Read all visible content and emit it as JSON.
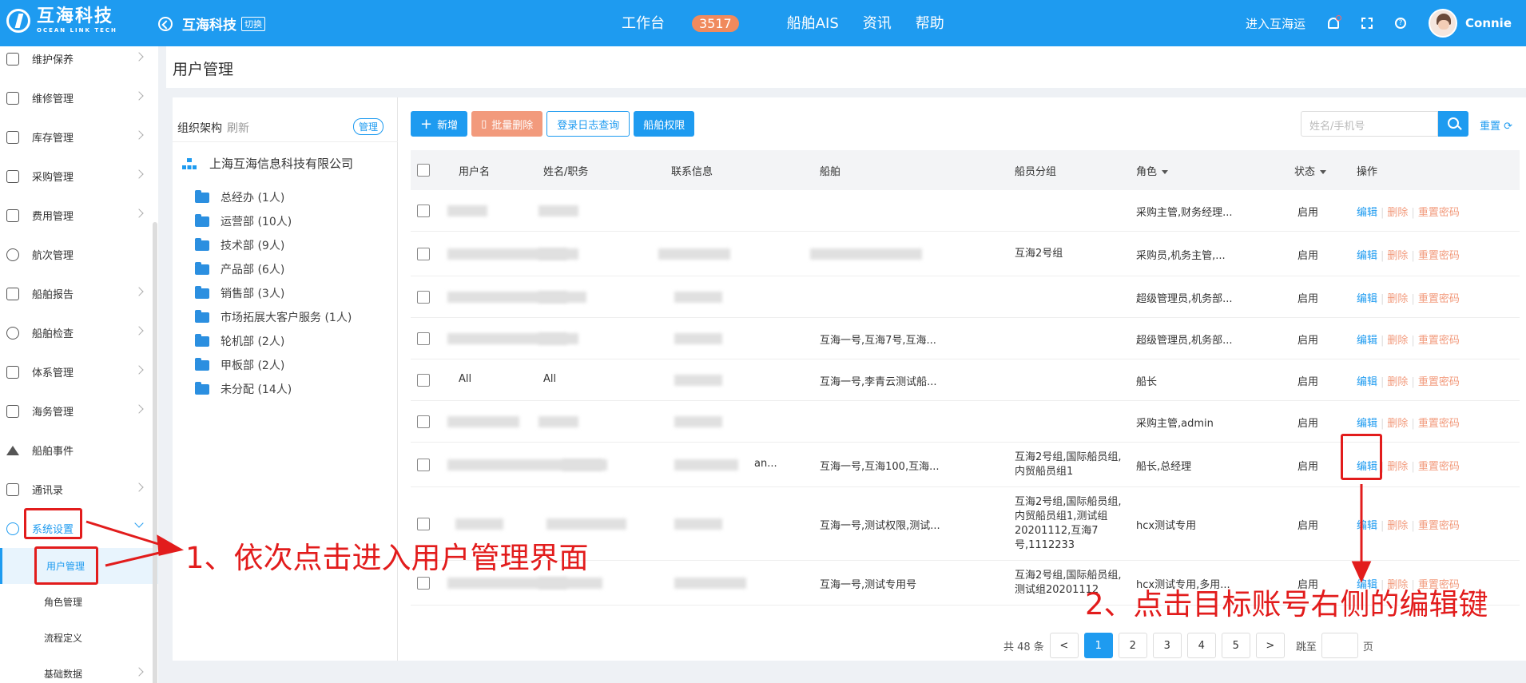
{
  "topbar": {
    "logo_cn": "互海科技",
    "logo_en": "OCEAN LINK TECH",
    "company": "互海科技",
    "switch_label": "切换",
    "nav": [
      {
        "label": "工作台",
        "badge": "3517"
      },
      {
        "label": "船舶AIS"
      },
      {
        "label": "资讯"
      },
      {
        "label": "帮助"
      }
    ],
    "enter_label": "进入互海运",
    "user": "Connie",
    "brand_color": "#1e9bf0"
  },
  "sidebar": {
    "items": [
      {
        "label": "维护保养",
        "icon": "hammer-icon"
      },
      {
        "label": "维修管理",
        "icon": "wrench-icon"
      },
      {
        "label": "库存管理",
        "icon": "warehouse-icon"
      },
      {
        "label": "采购管理",
        "icon": "cart-icon"
      },
      {
        "label": "费用管理",
        "icon": "database-icon"
      },
      {
        "label": "航次管理",
        "icon": "globe-icon"
      },
      {
        "label": "船舶报告",
        "icon": "calendar-icon"
      },
      {
        "label": "船舶检查",
        "icon": "check-circle-icon"
      },
      {
        "label": "体系管理",
        "icon": "document-icon"
      },
      {
        "label": "海务管理",
        "icon": "signpost-icon"
      },
      {
        "label": "船舶事件",
        "icon": "warning-icon"
      },
      {
        "label": "通讯录",
        "icon": "contacts-icon"
      },
      {
        "label": "系统设置",
        "icon": "gear-icon"
      }
    ],
    "subitems": [
      {
        "label": "用户管理"
      },
      {
        "label": "角色管理"
      },
      {
        "label": "流程定义"
      },
      {
        "label": "基础数据"
      }
    ]
  },
  "page_title": "用户管理",
  "org": {
    "title": "组织架构",
    "refresh": "刷新",
    "manage": "管理",
    "company": "上海互海信息科技有限公司",
    "departments": [
      "总经办 (1人)",
      "运营部 (10人)",
      "技术部 (9人)",
      "产品部 (6人)",
      "销售部 (3人)",
      "市场拓展大客户服务 (1人)",
      "轮机部 (2人)",
      "甲板部 (2人)",
      "未分配 (14人)"
    ]
  },
  "toolbar": {
    "add": "新增",
    "batch_delete": "批量删除",
    "login_log": "登录日志查询",
    "ship_perm": "船舶权限",
    "search_placeholder": "姓名/手机号",
    "reset": "重置"
  },
  "table": {
    "headers": [
      "用户名",
      "姓名/职务",
      "联系信息",
      "船舶",
      "船员分组",
      "角色",
      "状态",
      "操作"
    ],
    "op_edit": "编辑",
    "op_delete": "删除",
    "op_reset": "重置密码",
    "rows": [
      {
        "username": "",
        "name": "",
        "contact": "",
        "ship": "",
        "group": "",
        "role": "采购主管,财务经理...",
        "status": "启用"
      },
      {
        "username": "",
        "name": "",
        "contact": "",
        "ship": "",
        "group": "互海2号组",
        "role": "采购员,机务主管,...",
        "status": "启用"
      },
      {
        "username": "",
        "name": "",
        "contact": "",
        "ship": "",
        "group": "",
        "role": "超级管理员,机务部...",
        "status": "启用"
      },
      {
        "username": "",
        "name": "",
        "contact": "",
        "ship": "互海一号,互海7号,互海...",
        "group": "",
        "role": "超级管理员,机务部...",
        "status": "启用"
      },
      {
        "username": "All",
        "name": "All",
        "contact": "",
        "ship": "互海一号,李青云测试船...",
        "group": "",
        "role": "船长",
        "status": "启用"
      },
      {
        "username": "",
        "name": "",
        "contact": "",
        "ship": "",
        "group": "",
        "role": "采购主管,admin",
        "status": "启用"
      },
      {
        "username": "",
        "name": "",
        "contact": "an...",
        "ship": "互海一号,互海100,互海...",
        "group": "互海2号组,国际船员组,内贸船员组1",
        "role": "船长,总经理",
        "status": "启用"
      },
      {
        "username": "",
        "name": "",
        "contact": "",
        "ship": "互海一号,测试权限,测试...",
        "group": "互海2号组,国际船员组,内贸船员组1,测试组20201112,互海7号,1112233",
        "role": "hcx测试专用",
        "status": "启用"
      },
      {
        "username": "",
        "name": "",
        "contact": "",
        "ship": "互海一号,测试专用号",
        "group": "互海2号组,国际船员组,测试组20201112",
        "role": "hcx测试专用,多用...",
        "status": "启用"
      }
    ]
  },
  "pager": {
    "total": "共 48 条",
    "prev": "<",
    "pages": [
      "1",
      "2",
      "3",
      "4",
      "5"
    ],
    "next": ">",
    "jump": "跳至",
    "page_unit": "页"
  },
  "annotations": {
    "step1": "1、依次点击进入用户管理界面",
    "step2": "2、点击目标账号右侧的编辑键",
    "color": "#e21c1c"
  }
}
